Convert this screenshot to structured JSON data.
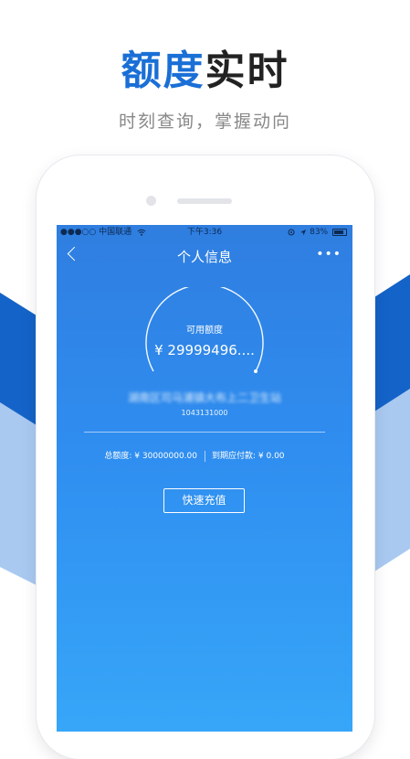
{
  "promo": {
    "headline_accent": "额度",
    "headline_rest": "实时",
    "subheadline": "时刻查询，掌握动向",
    "colors": {
      "accent": "#1a6fd6",
      "band_dark": "#1463c8",
      "band_light": "#a9c9f1"
    }
  },
  "status_bar": {
    "carrier": "●●●○○ 中国联通",
    "wifi_icon": "wifi-icon",
    "time": "下午3:36",
    "battery": "83%",
    "right_icons": [
      "alarm-icon",
      "location-arrow-icon",
      "battery-icon"
    ]
  },
  "nav": {
    "back_icon": "chevron-left-icon",
    "title": "个人信息",
    "more_icon": "more-dots-icon",
    "more_glyph": "•••"
  },
  "credit": {
    "label": "可用额度",
    "value": "¥ 29999496....",
    "station_name": "湖南区司马浦镇大布上二卫生站",
    "station_code": "1043131000"
  },
  "summary": {
    "total_credit": "总额度: ¥ 30000000.00",
    "amount_due": "到期应付款: ¥ 0.00"
  },
  "actions": {
    "recharge_label": "快速充值"
  }
}
